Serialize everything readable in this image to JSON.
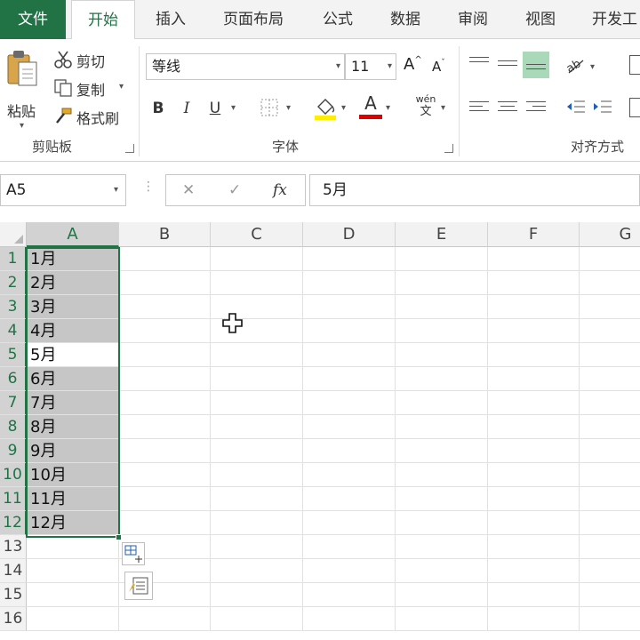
{
  "tabs": {
    "file": "文件",
    "home": "开始",
    "insert": "插入",
    "page_layout": "页面布局",
    "formulas": "公式",
    "data": "数据",
    "review": "审阅",
    "view": "视图",
    "developer": "开发工"
  },
  "clipboard": {
    "paste": "粘贴",
    "cut": "剪切",
    "copy": "复制",
    "format_painter": "格式刷",
    "group_label": "剪贴板"
  },
  "font": {
    "name": "等线",
    "size": "11",
    "grow": "A",
    "shrink": "A",
    "bold": "B",
    "italic": "I",
    "underline": "U",
    "font_color_letter": "A",
    "phonetic_top": "wén",
    "phonetic_bottom": "文",
    "group_label": "字体"
  },
  "alignment": {
    "group_label": "对齐方式"
  },
  "formula_bar": {
    "name_box": "A5",
    "cancel": "✕",
    "enter": "✓",
    "fx": "fx",
    "content": "5月"
  },
  "grid": {
    "columns": [
      "A",
      "B",
      "C",
      "D",
      "E",
      "F",
      "G"
    ],
    "rows": [
      "1",
      "2",
      "3",
      "4",
      "5",
      "6",
      "7",
      "8",
      "9",
      "10",
      "11",
      "12",
      "13",
      "14",
      "15",
      "16"
    ],
    "col_a_values": [
      "1月",
      "2月",
      "3月",
      "4月",
      "5月",
      "6月",
      "7月",
      "8月",
      "9月",
      "10月",
      "11月",
      "12月"
    ],
    "active_cell": "A5",
    "selection": "A1:A12"
  },
  "colors": {
    "accent": "#217346",
    "selection_fill": "#c6c6c6",
    "highlight_yellow": "#ffee00",
    "font_red": "#e00000"
  }
}
